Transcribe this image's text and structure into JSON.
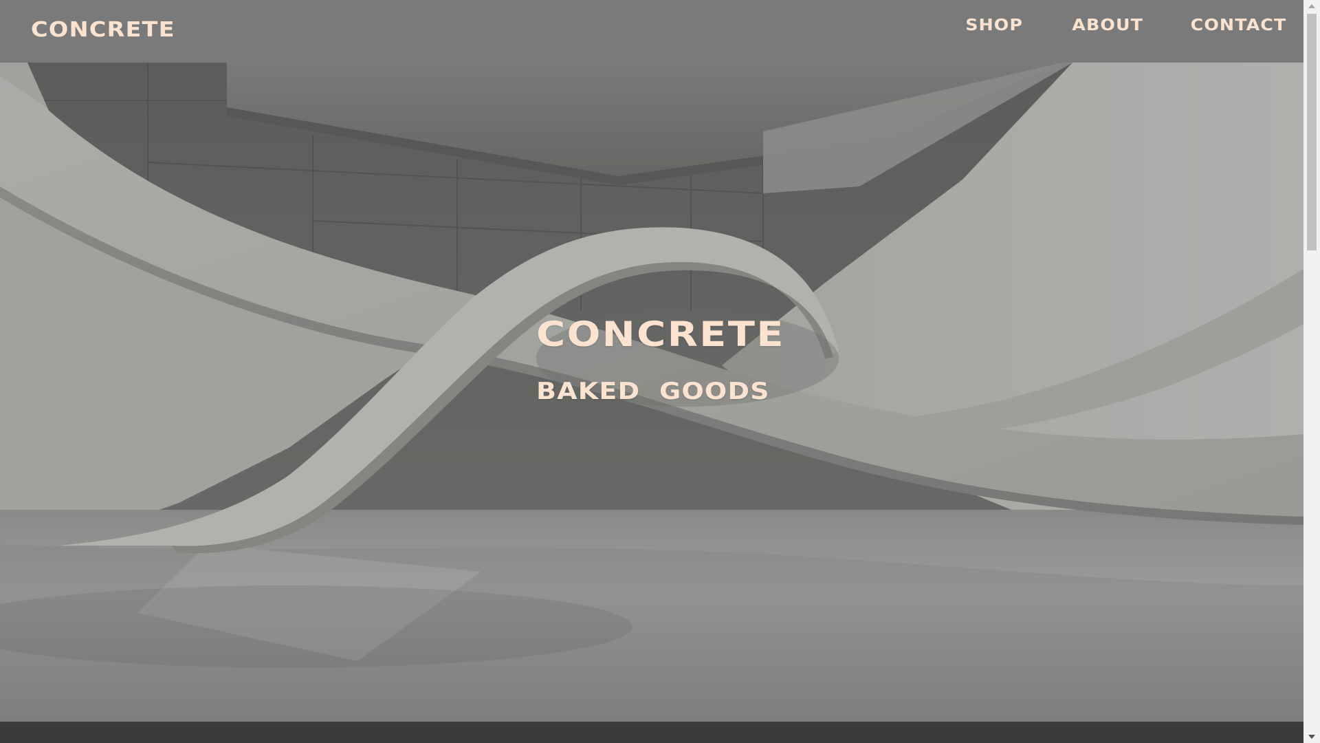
{
  "brand": {
    "logo": "CONCRETE"
  },
  "nav": {
    "items": [
      {
        "label": "SHOP"
      },
      {
        "label": "ABOUT"
      },
      {
        "label": "CONTACT"
      }
    ]
  },
  "hero": {
    "title": "CONCRETE",
    "subtitle_words": [
      "BAKED",
      "GOODS"
    ],
    "background": "concrete-architecture-image"
  },
  "colors": {
    "header_bg": "#7a7a7a",
    "text_accent": "#fbe3cf",
    "footer_bg": "#3b3b3b"
  },
  "icons": {
    "scroll_up": "chevron-up-icon",
    "scroll_down": "chevron-down-icon"
  }
}
